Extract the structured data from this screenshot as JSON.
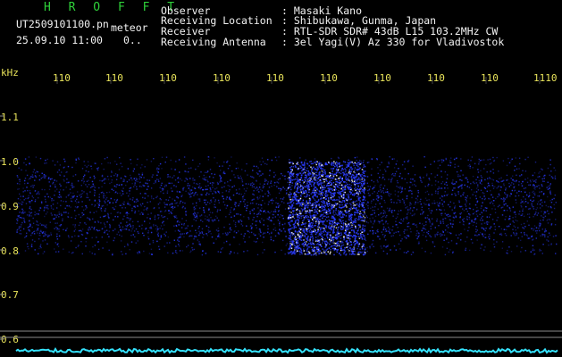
{
  "header": {
    "brand": "H R O F F T",
    "file_name": "UT2509101100.pn",
    "tag": "meteor",
    "datetime": "25.09.10 11:00",
    "counter": "0..",
    "info": [
      {
        "label": "Observer",
        "value": ": Masaki Kano"
      },
      {
        "label": "Receiving Location",
        "value": ": Shibukawa, Gunma, Japan"
      },
      {
        "label": "Receiver",
        "value": ": RTL-SDR SDR# 43dB L15 103.2MHz CW"
      },
      {
        "label": "Receiving Antenna",
        "value": ": 3el Yagi(V) Az 330 for Vladivostok"
      }
    ]
  },
  "spectrogram": {
    "unit_label": "kHz",
    "time_ticks": [
      "110",
      "110",
      "110",
      "110",
      "110",
      "110",
      "110",
      "110",
      "110",
      "1110"
    ],
    "freq_ticks": [
      "1.1",
      "1.0",
      "0.9",
      "0.8",
      "0.7",
      "0.6"
    ],
    "colors": {
      "background": "#000000",
      "signal": "#2b3cff",
      "grid": "#8a8a8a",
      "trace": "#35e3ff",
      "axis_text": "#e8e35a"
    }
  }
}
